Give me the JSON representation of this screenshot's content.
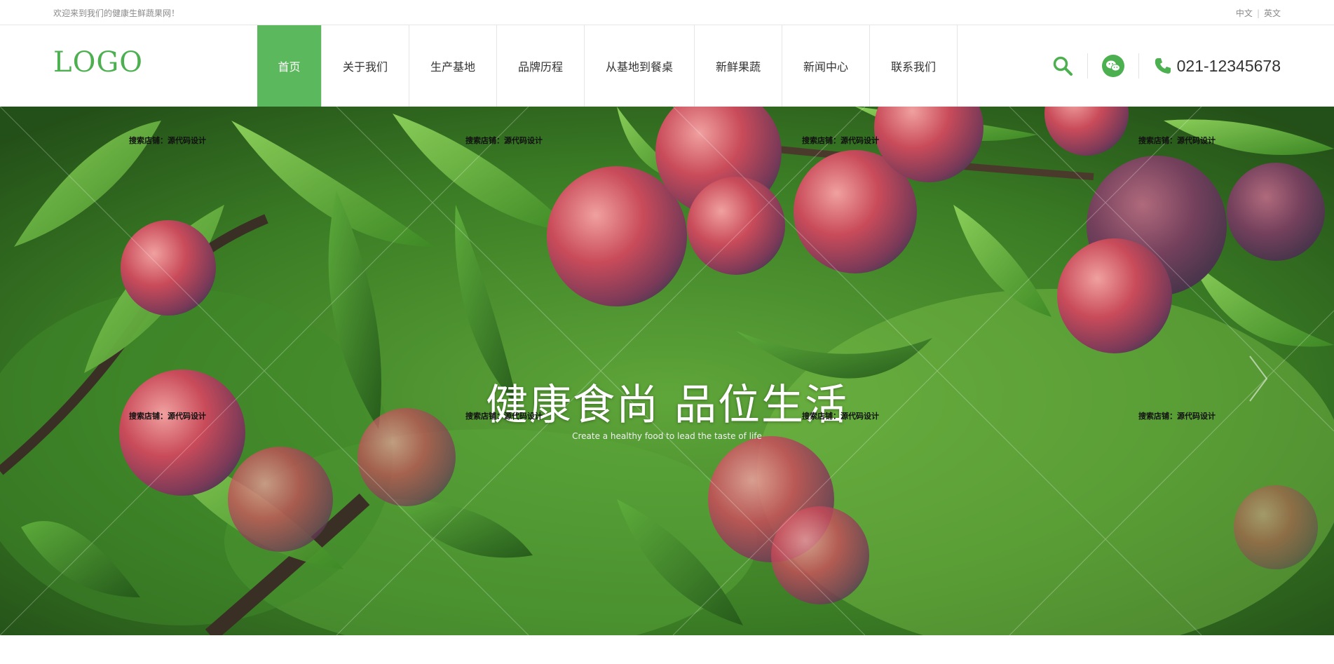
{
  "colors": {
    "accent": "#5cb85c",
    "logo": "#4caf50",
    "icon": "#4caf50"
  },
  "topbar": {
    "welcome": "欢迎来到我们的健康生鲜蔬果网！",
    "lang_cn": "中文",
    "lang_sep": "|",
    "lang_en": "英文"
  },
  "logo": "LOGO",
  "nav": [
    {
      "label": "首页",
      "active": true
    },
    {
      "label": "关于我们"
    },
    {
      "label": "生产基地"
    },
    {
      "label": "品牌历程"
    },
    {
      "label": "从基地到餐桌"
    },
    {
      "label": "新鲜果蔬"
    },
    {
      "label": "新闻中心"
    },
    {
      "label": "联系我们"
    }
  ],
  "tools": {
    "search_icon": "search-icon",
    "wechat_icon": "wechat-icon",
    "phone_icon": "phone-icon",
    "phone": "021-12345678"
  },
  "hero": {
    "title": "健康食尚 品位生活",
    "subtitle": "Create a healthy food to lead the taste of life",
    "watermark": "搜索店铺：源代码设计"
  }
}
